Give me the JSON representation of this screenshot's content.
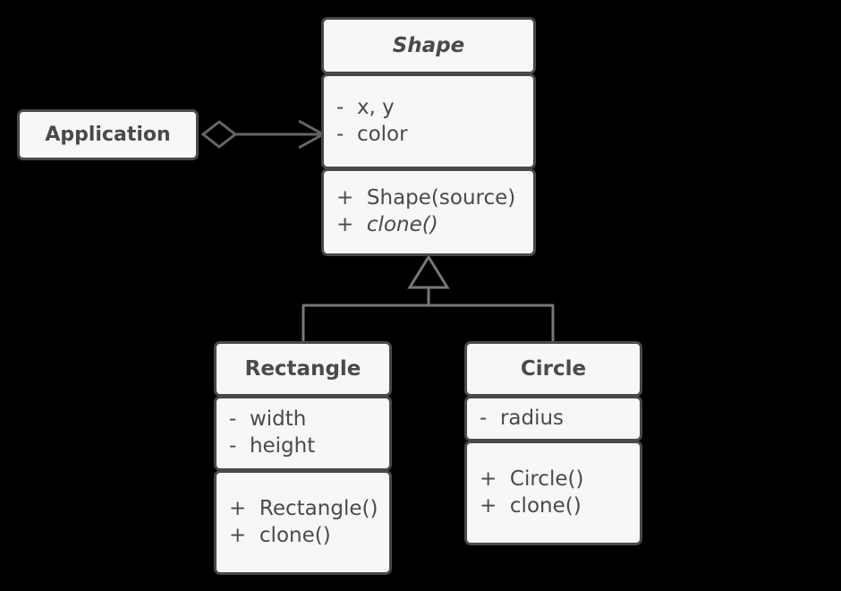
{
  "diagram": {
    "type": "uml-class-diagram",
    "background_color": "#000000",
    "box_fill": "#f7f7f7",
    "box_border": "#494949",
    "text_color": "#4a4a4a",
    "edge_color": "#666666"
  },
  "classes": {
    "application": {
      "name": "Application"
    },
    "shape": {
      "name": "Shape",
      "is_abstract": true,
      "attributes": [
        {
          "visibility": "-",
          "signature": "x, y"
        },
        {
          "visibility": "-",
          "signature": "color"
        }
      ],
      "methods": [
        {
          "visibility": "+",
          "signature": "Shape(source)",
          "is_abstract": false
        },
        {
          "visibility": "+",
          "signature": "clone()",
          "is_abstract": true
        }
      ]
    },
    "rectangle": {
      "name": "Rectangle",
      "is_abstract": false,
      "attributes": [
        {
          "visibility": "-",
          "signature": "width"
        },
        {
          "visibility": "-",
          "signature": "height"
        }
      ],
      "methods": [
        {
          "visibility": "+",
          "signature": "Rectangle()",
          "is_abstract": false
        },
        {
          "visibility": "+",
          "signature": "clone()",
          "is_abstract": false
        }
      ]
    },
    "circle": {
      "name": "Circle",
      "is_abstract": false,
      "attributes": [
        {
          "visibility": "-",
          "signature": "radius"
        }
      ],
      "methods": [
        {
          "visibility": "+",
          "signature": "Circle()",
          "is_abstract": false
        },
        {
          "visibility": "+",
          "signature": "clone()",
          "is_abstract": false
        }
      ]
    }
  },
  "relationships": [
    {
      "kind": "aggregation",
      "from": "Application",
      "to": "Shape",
      "source_decoration": "hollow-diamond",
      "target_decoration": "open-arrow"
    },
    {
      "kind": "generalization",
      "from": "Rectangle",
      "to": "Shape",
      "target_decoration": "hollow-triangle"
    },
    {
      "kind": "generalization",
      "from": "Circle",
      "to": "Shape",
      "target_decoration": "hollow-triangle"
    }
  ]
}
